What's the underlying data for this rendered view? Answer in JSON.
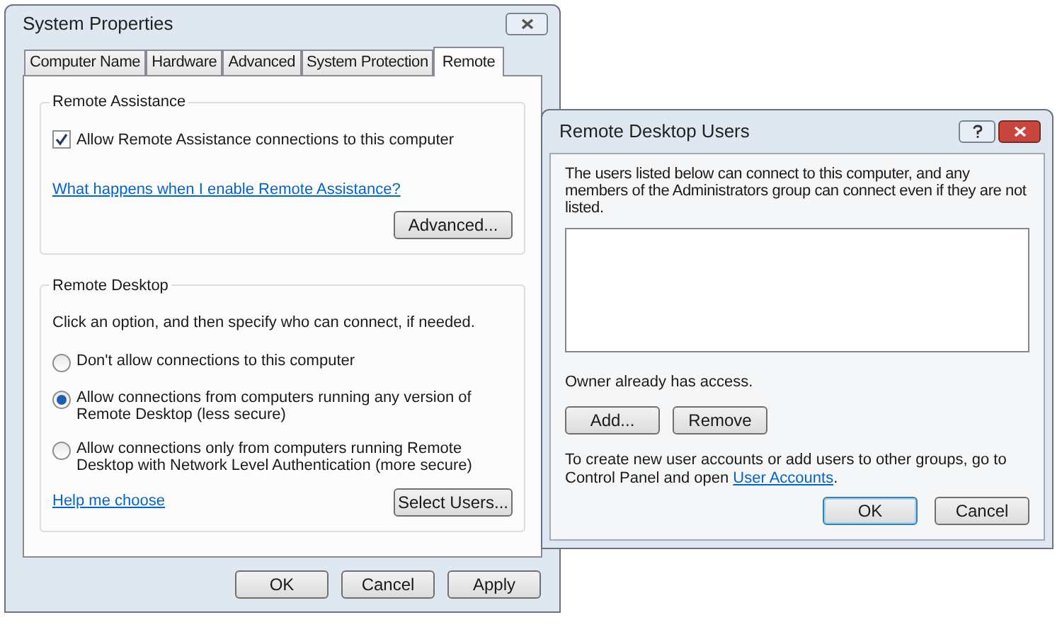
{
  "system_properties": {
    "title": "System Properties",
    "tabs": [
      {
        "label": "Computer Name",
        "selected": false
      },
      {
        "label": "Hardware",
        "selected": false
      },
      {
        "label": "Advanced",
        "selected": false
      },
      {
        "label": "System Protection",
        "selected": false
      },
      {
        "label": "Remote",
        "selected": true
      }
    ],
    "remote_assistance": {
      "heading": "Remote Assistance",
      "checkbox": {
        "label": "Allow Remote Assistance connections to this computer",
        "checked": true
      },
      "link": "What happens when I enable Remote Assistance?",
      "button": "Advanced..."
    },
    "remote_desktop": {
      "heading": "Remote Desktop",
      "instruction": "Click an option, and then specify who can connect, if needed.",
      "options": [
        {
          "label": "Don't allow connections to this computer",
          "selected": false
        },
        {
          "label": "Allow connections from computers running any version of Remote Desktop (less secure)",
          "selected": true
        },
        {
          "label": "Allow connections only from computers running Remote Desktop with Network Level Authentication (more secure)",
          "selected": false
        }
      ],
      "link": "Help me choose",
      "button": "Select Users..."
    },
    "buttons": [
      {
        "label": "OK",
        "default": false
      },
      {
        "label": "Cancel",
        "default": false
      },
      {
        "label": "Apply",
        "default": false
      }
    ]
  },
  "remote_desktop_users": {
    "title": "Remote Desktop Users",
    "description": "The users listed below can connect to this computer, and any members of the Administrators group can connect even if they are not listed.",
    "access_note": "Owner already has access.",
    "list_buttons": [
      "Add...",
      "Remove"
    ],
    "footer": {
      "text": "To create new user accounts or add users to other groups, go to Control Panel and open ",
      "link": "User Accounts",
      "suffix": "."
    },
    "buttons": [
      {
        "label": "OK",
        "default": true
      },
      {
        "label": "Cancel",
        "default": false
      }
    ]
  }
}
